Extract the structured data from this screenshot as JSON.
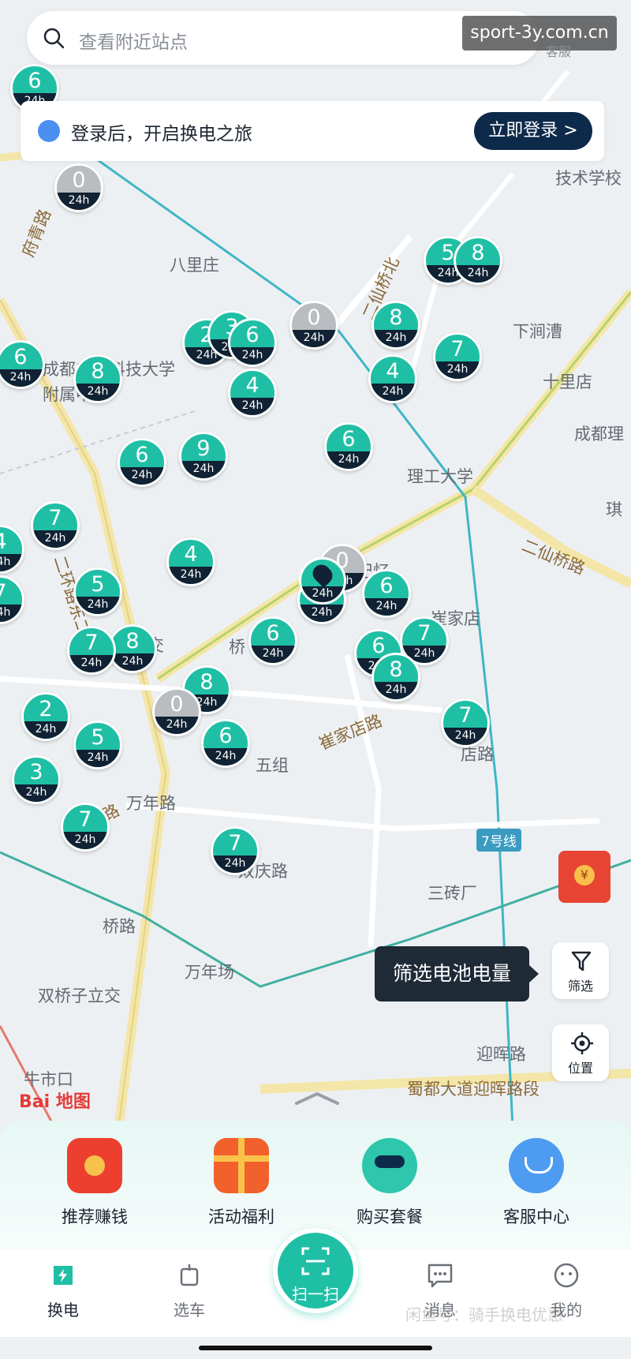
{
  "search": {
    "placeholder": "查看附近站点"
  },
  "watermark": "sport-3y.com.cn",
  "top_service_label": "客服",
  "login_banner": {
    "message": "登录后，开启换电之旅",
    "button": "立即登录 >"
  },
  "map_labels": [
    {
      "id": "l1",
      "text": "八里庄"
    },
    {
      "id": "l2",
      "text": "成都电子科技大学"
    },
    {
      "id": "l3",
      "text": "附属中学"
    },
    {
      "id": "l4",
      "text": "下涧漕"
    },
    {
      "id": "l5",
      "text": "十里店"
    },
    {
      "id": "l6",
      "text": "成都理"
    },
    {
      "id": "l7",
      "text": "理工大学"
    },
    {
      "id": "l8",
      "text": "技术学校"
    },
    {
      "id": "l9",
      "text": "崔家店"
    },
    {
      "id": "l10",
      "text": "三砖厂"
    },
    {
      "id": "l11",
      "text": "万年场"
    },
    {
      "id": "l12",
      "text": "双桥子立交"
    },
    {
      "id": "l13",
      "text": "迎晖路"
    },
    {
      "id": "l14",
      "text": "牛市口"
    },
    {
      "id": "l15",
      "text": "双庆路"
    },
    {
      "id": "l16",
      "text": "五组"
    },
    {
      "id": "l17",
      "text": "万年路"
    },
    {
      "id": "l18",
      "text": "立交"
    },
    {
      "id": "l19",
      "text": "桥"
    },
    {
      "id": "l20",
      "text": "记忆"
    },
    {
      "id": "l21",
      "text": "店路"
    },
    {
      "id": "l22",
      "text": "桥路"
    },
    {
      "id": "l23",
      "text": "琪"
    }
  ],
  "road_labels": [
    {
      "id": "r1",
      "text": "二环路东二段"
    },
    {
      "id": "r2",
      "text": "二仙桥路"
    },
    {
      "id": "r3",
      "text": "崔家店路"
    },
    {
      "id": "r4",
      "text": "蜀都大道迎晖路段"
    },
    {
      "id": "r5",
      "text": "双林路"
    },
    {
      "id": "r6",
      "text": "府青路"
    },
    {
      "id": "r7",
      "text": "二仙桥北"
    },
    {
      "id": "r8",
      "text": "7号线"
    }
  ],
  "stations": [
    {
      "num": "6",
      "hours": "24h",
      "grey": false
    },
    {
      "num": "0",
      "hours": "24h",
      "grey": true
    },
    {
      "num": "5",
      "hours": "24h",
      "grey": false
    },
    {
      "num": "8",
      "hours": "24h",
      "grey": false
    },
    {
      "num": "0",
      "hours": "24h",
      "grey": true
    },
    {
      "num": "8",
      "hours": "24h",
      "grey": false
    },
    {
      "num": "7",
      "hours": "24h",
      "grey": false
    },
    {
      "num": "4",
      "hours": "24h",
      "grey": false
    },
    {
      "num": "2",
      "hours": "24h",
      "grey": false
    },
    {
      "num": "3",
      "hours": "24h",
      "grey": false
    },
    {
      "num": "6",
      "hours": "24h",
      "grey": false
    },
    {
      "num": "6",
      "hours": "24h",
      "grey": false
    },
    {
      "num": "8",
      "hours": "24h",
      "grey": false
    },
    {
      "num": "4",
      "hours": "24h",
      "grey": false
    },
    {
      "num": "6",
      "hours": "24h",
      "grey": false
    },
    {
      "num": "9",
      "hours": "24h",
      "grey": false
    },
    {
      "num": "6",
      "hours": "24h",
      "grey": false
    },
    {
      "num": "7",
      "hours": "24h",
      "grey": false
    },
    {
      "num": "4",
      "hours": "24h",
      "grey": false
    },
    {
      "num": "4",
      "hours": "24h",
      "grey": false
    },
    {
      "num": "5",
      "hours": "24h",
      "grey": false
    },
    {
      "num": "0",
      "hours": "24h",
      "grey": true
    },
    {
      "num": "6",
      "hours": "24h",
      "grey": false
    },
    {
      "num": "6",
      "hours": "24h",
      "grey": false
    },
    {
      "num": "7",
      "hours": "24h",
      "grey": false
    },
    {
      "num": "8",
      "hours": "24h",
      "grey": false
    },
    {
      "num": "7",
      "hours": "24h",
      "grey": false
    },
    {
      "num": "6",
      "hours": "24h",
      "grey": false
    },
    {
      "num": "6",
      "hours": "24h",
      "grey": false
    },
    {
      "num": "8",
      "hours": "24h",
      "grey": false
    },
    {
      "num": "8",
      "hours": "24h",
      "grey": false
    },
    {
      "num": "0",
      "hours": "24h",
      "grey": true
    },
    {
      "num": "7",
      "hours": "24h",
      "grey": false
    },
    {
      "num": "2",
      "hours": "24h",
      "grey": false
    },
    {
      "num": "5",
      "hours": "24h",
      "grey": false
    },
    {
      "num": "6",
      "hours": "24h",
      "grey": false
    },
    {
      "num": "3",
      "hours": "24h",
      "grey": false
    },
    {
      "num": "7",
      "hours": "24h",
      "grey": false
    },
    {
      "num": "7",
      "hours": "24h",
      "grey": false
    },
    {
      "num": "7",
      "hours": "24h",
      "grey": false
    }
  ],
  "my_location": {
    "hours": "24h"
  },
  "controls": {
    "filter_tooltip": "筛选电池电量",
    "filter_label": "筛选",
    "locate_label": "位置"
  },
  "baidu_logo": "Bai 地图",
  "features": [
    {
      "label": "推荐赚钱",
      "icon": "red-envelope-icon"
    },
    {
      "label": "活动福利",
      "icon": "gift-box-icon"
    },
    {
      "label": "购买套餐",
      "icon": "mascot-icon"
    },
    {
      "label": "客服中心",
      "icon": "headset-icon"
    }
  ],
  "tabs": [
    {
      "label": "换电",
      "icon": "battery-swap-icon",
      "active": true
    },
    {
      "label": "选车",
      "icon": "bike-icon",
      "active": false
    },
    {
      "label": "消息",
      "icon": "message-icon",
      "active": false
    },
    {
      "label": "我的",
      "icon": "profile-icon",
      "active": false
    }
  ],
  "scan": {
    "label": "扫一扫"
  },
  "corner_watermark": "闲鱼号：骑手换电优惠",
  "colors": {
    "accent": "#1fbfa5",
    "pin_base": "#102233",
    "login_button": "#0d2a4a"
  }
}
